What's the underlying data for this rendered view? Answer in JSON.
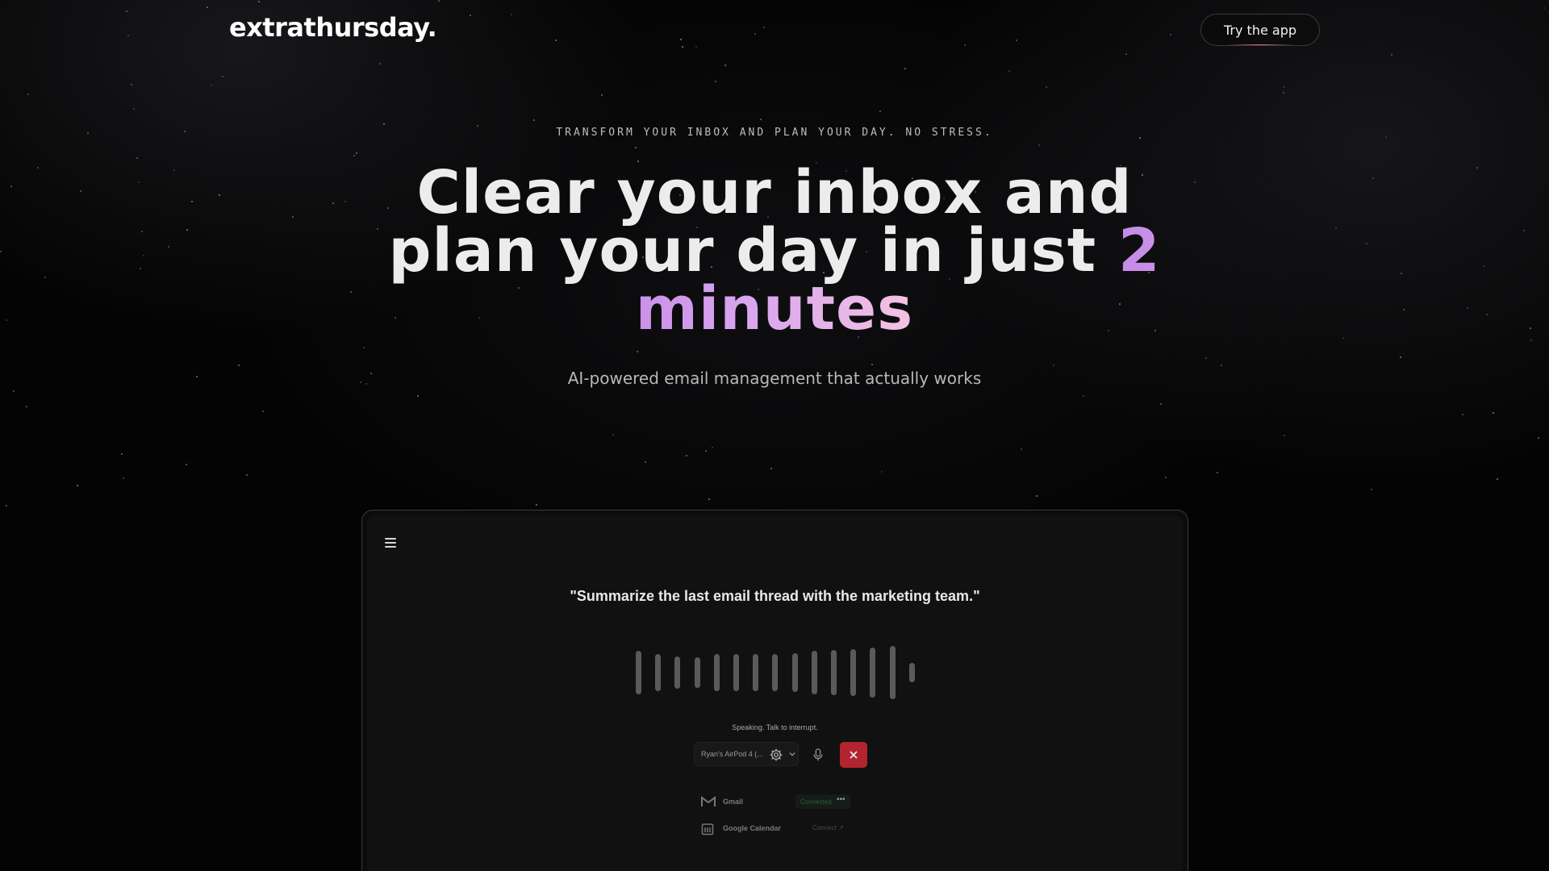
{
  "nav": {
    "logo": "extrathursday.",
    "cta_label": "Try the app"
  },
  "hero": {
    "eyebrow": "TRANSFORM YOUR INBOX AND PLAN YOUR DAY. NO STRESS.",
    "headline_plain": "Clear your inbox and plan your day in just ",
    "headline_accent": "2 minutes",
    "subtitle": "AI-powered email management that actually works"
  },
  "app_preview": {
    "quote": "\"Summarize the last email thread with the marketing team.\"",
    "status": "Speaking. Talk to interrupt.",
    "device_label": "Ryan's AirPod 4 (...",
    "integrations": [
      {
        "name": "Gmail",
        "state": "Connected",
        "icon": "gmail-icon"
      },
      {
        "name": "Google Calendar",
        "state": "Connect",
        "icon": "calendar-icon"
      }
    ],
    "colors": {
      "stop_button": "#b3242f",
      "accent_gradient_start": "#c48ae6",
      "accent_gradient_end": "#f4c2e2"
    }
  }
}
